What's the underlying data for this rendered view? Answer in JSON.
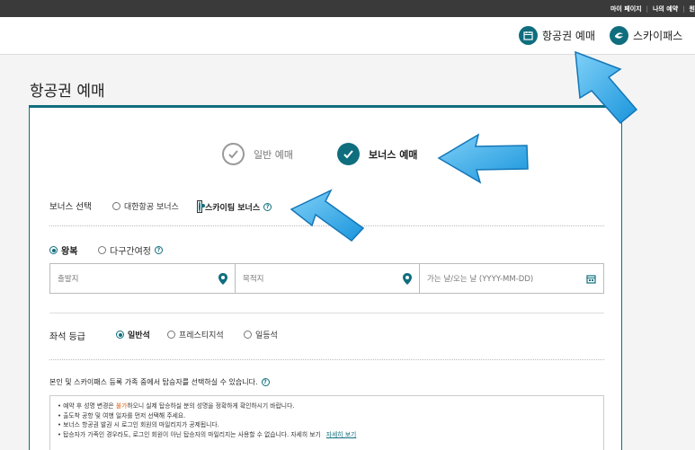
{
  "topbar": {
    "links": [
      "마이 페이지",
      "나의 예약",
      "원"
    ]
  },
  "header": {
    "booking_label": "항공권 예매",
    "skypass_label": "스카이패스"
  },
  "page_title": "항공권 예매",
  "tabs": {
    "normal": "일반 예매",
    "bonus": "보너스 예매"
  },
  "bonus_select": {
    "label": "보너스 선택",
    "options": [
      "대한항공 보너스",
      "스카이팀 보너스"
    ],
    "selected": "스카이팀 보너스"
  },
  "trip_type": {
    "options": [
      "왕복",
      "다구간여정"
    ],
    "selected": "왕복"
  },
  "search": {
    "origin_placeholder": "출발지",
    "destination_placeholder": "목적지",
    "date_placeholder": "가는 날/오는 날 (YYYY-MM-DD)"
  },
  "seat_class": {
    "label": "좌석 등급",
    "options": [
      "일반석",
      "프레스티지석",
      "일등석"
    ],
    "selected": "일반석"
  },
  "notice": {
    "title": "본인 및 스카이패스 등록 가족 중에서 탑승자를 선택하실 수 있습니다.",
    "line1_a": "예약 후 성명 변경은 ",
    "line1_hl": "불가",
    "line1_b": "하오니 실제 탑승하실 분의 성명을 정확하게 확인하시기 바랍니다.",
    "line2": "출도착 공항 및 여행 일자를 먼저 선택해 주세요.",
    "line3": "보너스 항공권 발권 시 로그인 회원의 마일리지가 공제됩니다.",
    "line4": "탑승자가 가족인 경우라도, 로그인 회원이 아닌 탑승자의 마일리지는 사용할 수 없습니다. 자세히 보기",
    "link": "자세히 보기"
  },
  "colors": {
    "accent": "#0f6e7e",
    "arrow": "#2aa6e8",
    "topbar": "#3a3a3a"
  }
}
